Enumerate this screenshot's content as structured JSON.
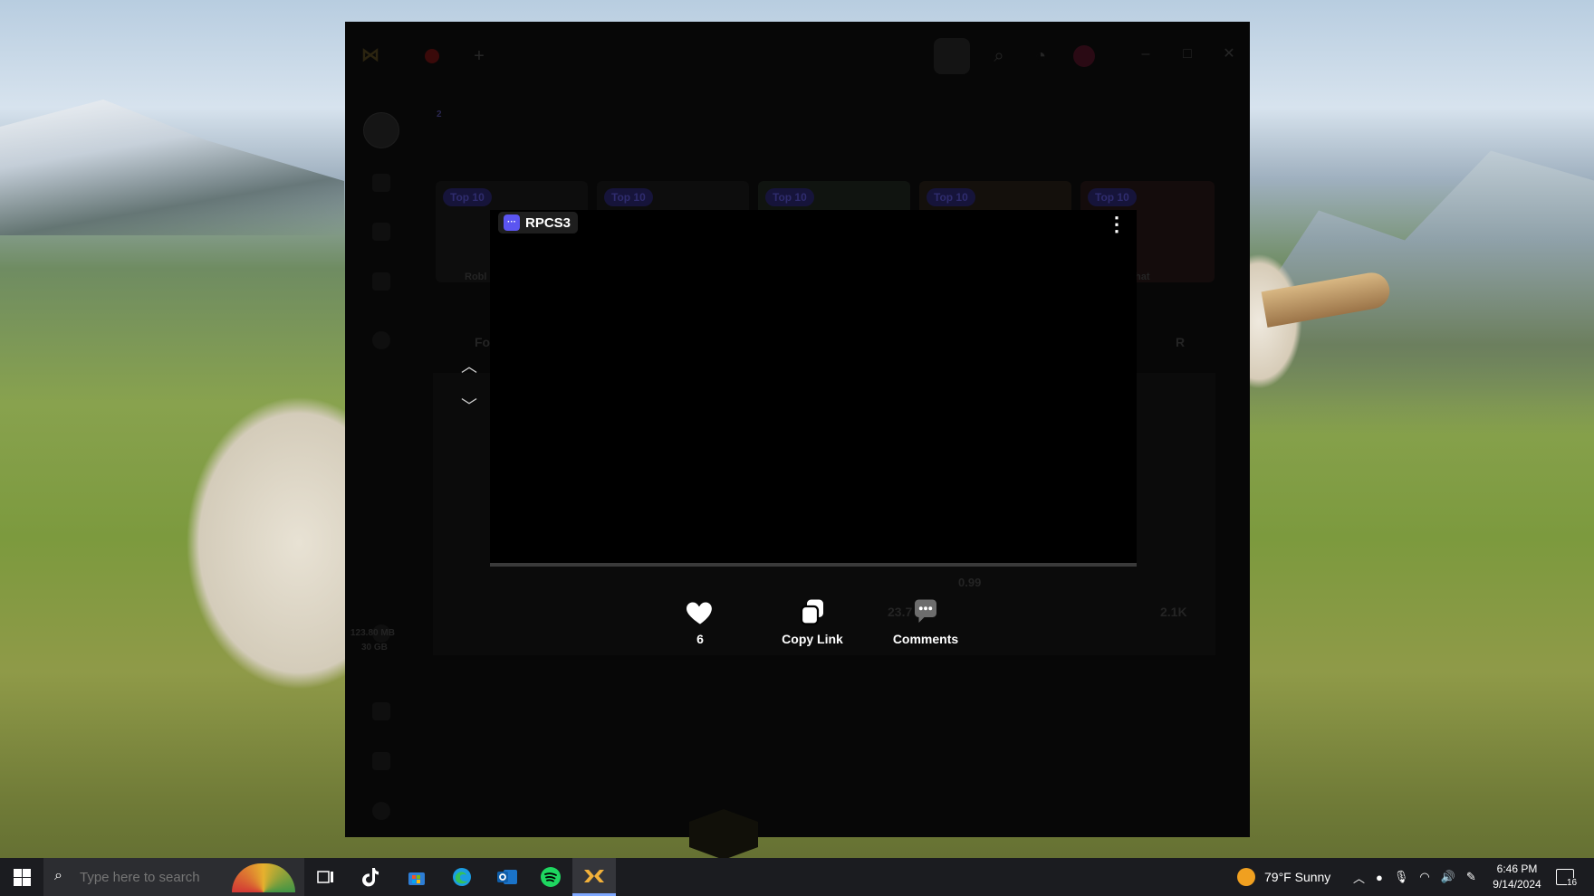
{
  "player": {
    "app_name": "RPCS3",
    "app_logo_text": "···"
  },
  "actions": {
    "likes_count": "6",
    "copy_link_label": "Copy Link",
    "comments_label": "Comments"
  },
  "background_app": {
    "tags": [
      "Top 10",
      "Top 10",
      "Top 10",
      "Top 10",
      "Top 10"
    ],
    "notification_badge": "2",
    "feed_label_left": "Fo",
    "feed_count": "23.7",
    "views": "2.1K",
    "price": "0.99",
    "sidebar_stats": [
      "123.80 MB",
      "30 GB"
    ],
    "card_labels": [
      "Robl",
      "hat"
    ],
    "filter_label": "R"
  },
  "taskbar": {
    "search_placeholder": "Type here to search",
    "weather": "79°F  Sunny",
    "time": "6:46 PM",
    "date": "9/14/2024",
    "notification_count": "16"
  }
}
